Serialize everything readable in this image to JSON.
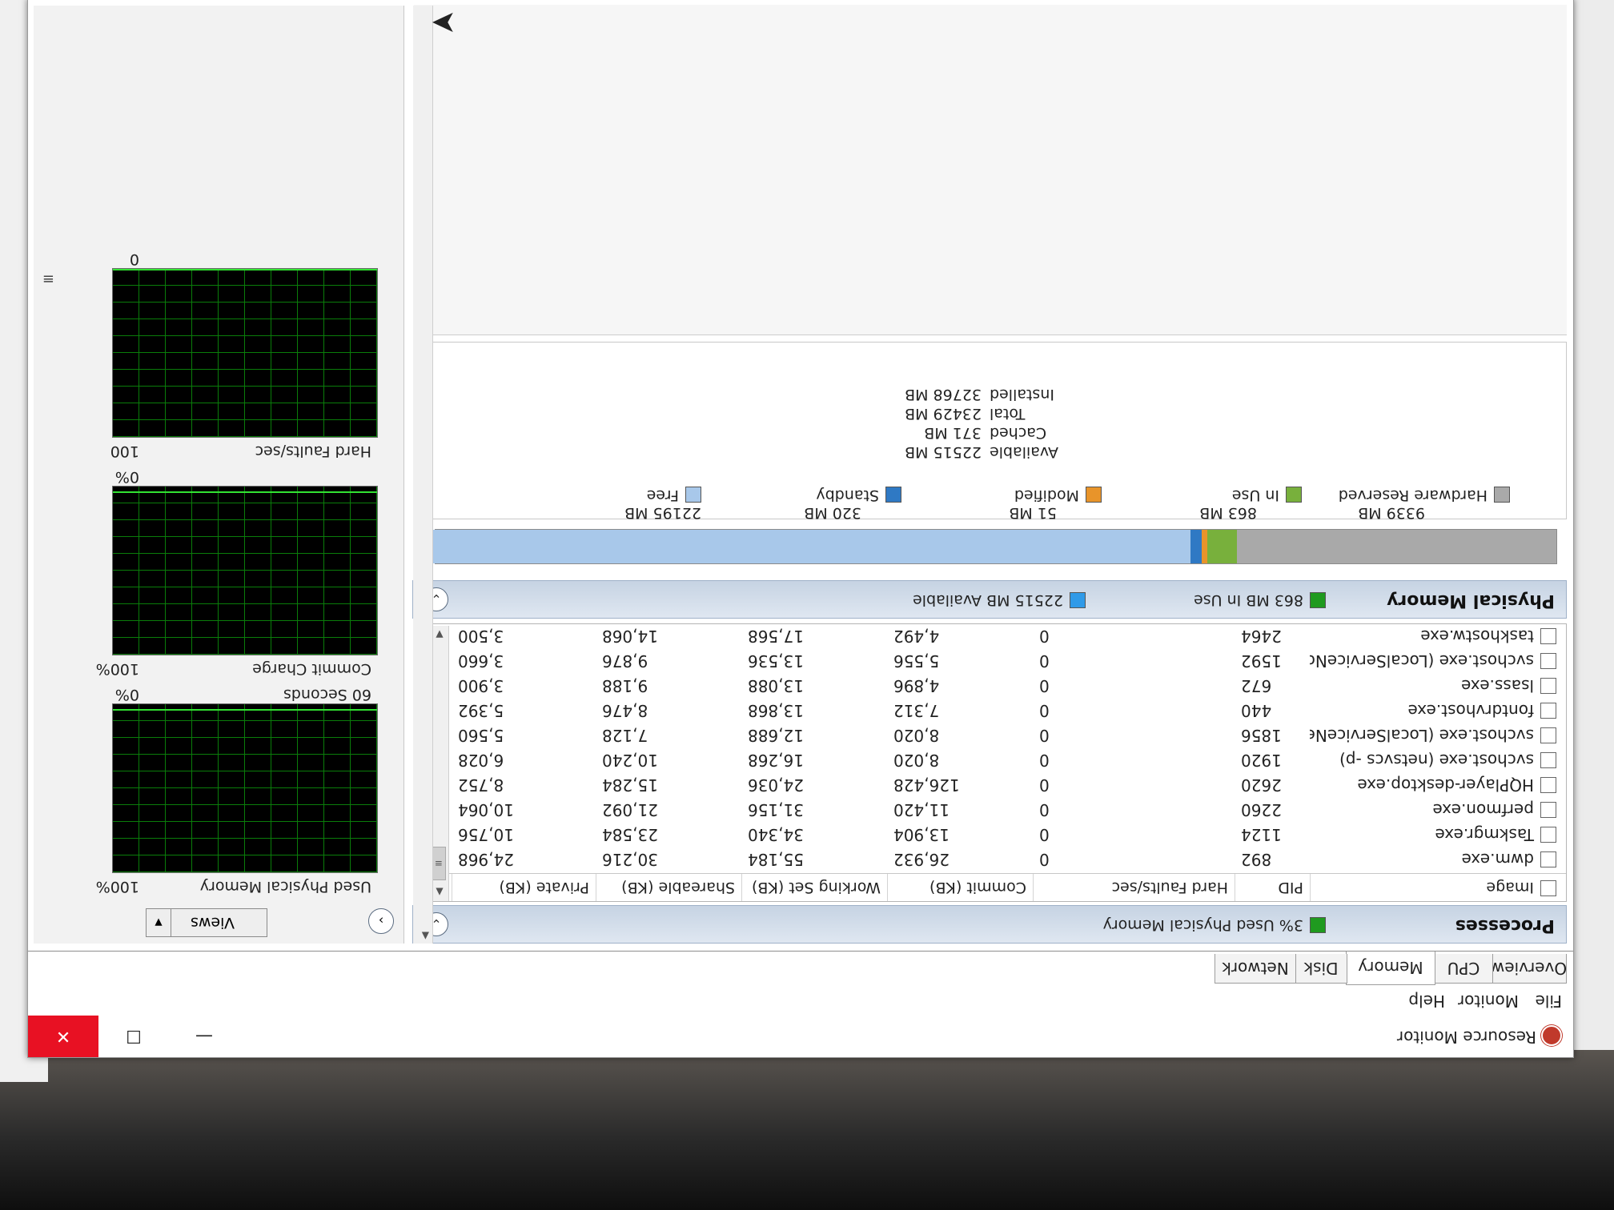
{
  "window": {
    "title": "Resource Monitor",
    "controls": {
      "minimize": "—",
      "maximize": "☐",
      "close": "✕"
    }
  },
  "menu": [
    "File",
    "Monitor",
    "Help"
  ],
  "tabs": [
    "Overview",
    "CPU",
    "Memory",
    "Disk",
    "Network"
  ],
  "active_tab": "Memory",
  "processes": {
    "title": "Processes",
    "legend": "3% Used Physical Memory",
    "columns": [
      "Image",
      "PID",
      "Hard Faults/sec",
      "Commit (KB)",
      "Working Set (KB)",
      "Shareable (KB)",
      "Private (KB)"
    ],
    "rows": [
      [
        "dwm.exe",
        "892",
        "0",
        "26,932",
        "55,184",
        "30,216",
        "24,968"
      ],
      [
        "Taskmgr.exe",
        "1124",
        "0",
        "13,904",
        "34,340",
        "23,584",
        "10,756"
      ],
      [
        "perfmon.exe",
        "2260",
        "0",
        "11,420",
        "31,156",
        "21,092",
        "10,064"
      ],
      [
        "HQPlayer-desktop.exe",
        "2620",
        "0",
        "126,428",
        "24,036",
        "15,284",
        "8,752"
      ],
      [
        "svchost.exe (netsvcs -p)",
        "1920",
        "0",
        "8,020",
        "16,268",
        "10,240",
        "6,028"
      ],
      [
        "svchost.exe (LocalServiceNet...",
        "1856",
        "0",
        "8,020",
        "12,688",
        "7,128",
        "5,560"
      ],
      [
        "fontdrvhost.exe",
        "440",
        "0",
        "7,312",
        "13,868",
        "8,476",
        "5,392"
      ],
      [
        "lsass.exe",
        "672",
        "0",
        "4,896",
        "13,088",
        "9,188",
        "3,900"
      ],
      [
        "svchost.exe (LocalServiceNo...",
        "1592",
        "0",
        "5,556",
        "13,536",
        "9,876",
        "3,660"
      ],
      [
        "taskhostw.exe",
        "2464",
        "0",
        "4,492",
        "17,568",
        "14,068",
        "3,500"
      ]
    ]
  },
  "physical_memory": {
    "title": "Physical Memory",
    "in_use_label": "863 MB In Use",
    "available_label": "22515 MB Available",
    "legend": {
      "hardware_reserved": {
        "label": "Hardware Reserved",
        "value": "9339 MB",
        "color": "#a9a9a9"
      },
      "in_use": {
        "label": "In Use",
        "value": "863 MB",
        "color": "#78b03c"
      },
      "modified": {
        "label": "Modified",
        "value": "51 MB",
        "color": "#e8942a"
      },
      "standby": {
        "label": "Standby",
        "value": "320 MB",
        "color": "#2f79c4"
      },
      "free": {
        "label": "Free",
        "value": "22195 MB",
        "color": "#a8c8ea"
      }
    },
    "stats": [
      {
        "label": "Available",
        "value": "22515 MB"
      },
      {
        "label": "Cached",
        "value": "371 MB"
      },
      {
        "label": "Total",
        "value": "23429 MB"
      },
      {
        "label": "Installed",
        "value": "32768 MB"
      }
    ]
  },
  "side_panel": {
    "views_label": "Views",
    "graphs": [
      {
        "title": "Used Physical Memory",
        "max": "100%",
        "min": "0%",
        "level": 0.03
      },
      {
        "title": "Commit Charge",
        "max": "100%",
        "min": "0%",
        "level": 0.03
      },
      {
        "title": "Hard Faults/sec",
        "max": "100",
        "min": "0",
        "level": 0.0
      }
    ],
    "time_label": "60 Seconds"
  },
  "colors": {
    "accent_header": "#c6d3e3",
    "graph_bg": "#000000",
    "graph_grid": "#0a7d0a",
    "graph_line": "#32e232",
    "close_red": "#e81123"
  }
}
